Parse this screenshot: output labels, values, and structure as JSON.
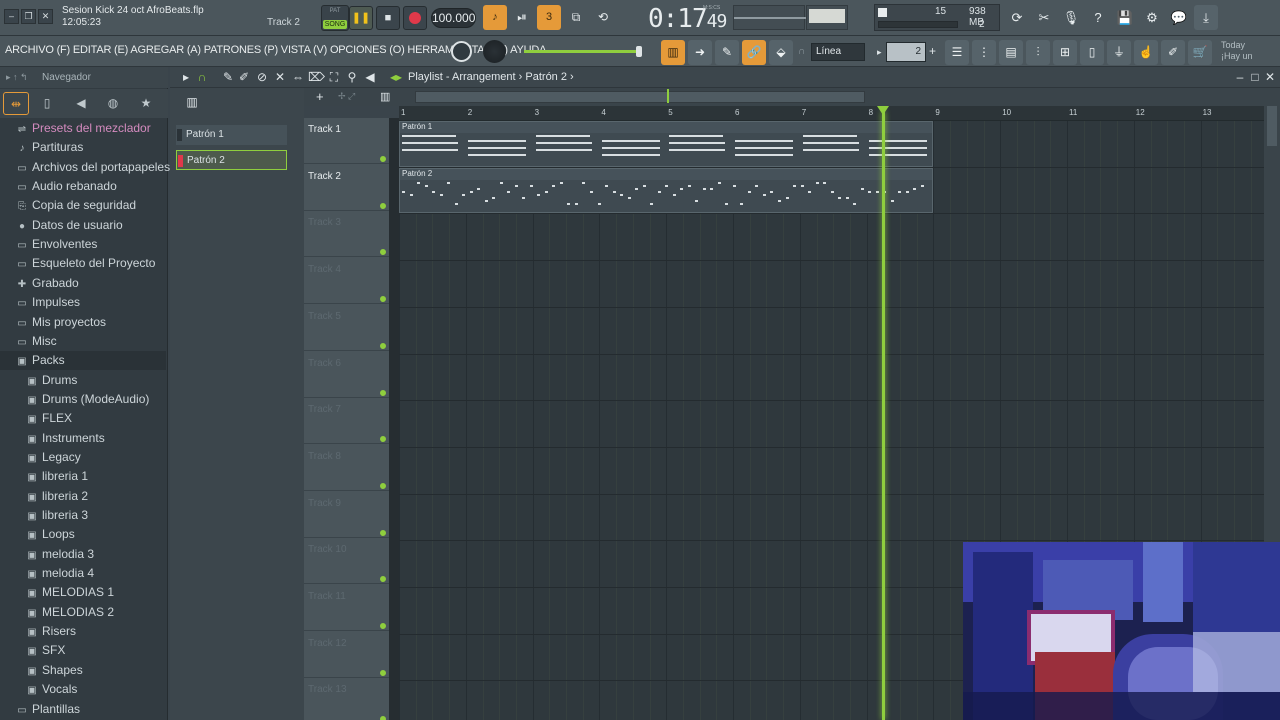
{
  "window": {
    "project_name": "Sesion Kick 24 oct AfroBeats.flp",
    "time": "12:05:23",
    "track_hint": "Track 2"
  },
  "transport": {
    "pat_label": "PAT",
    "song_label": "SONG",
    "tempo": "100.000",
    "clock_main": "0:17",
    "clock_sec": "49",
    "clock_unit": "M:S:CS",
    "cpu_percent": "15",
    "memory": "938 MB",
    "polyphony": "2"
  },
  "menu": {
    "text": "ARCHIVO (F) EDITAR (E) AGREGAR (A) PATRONES (P) VISTA (V) OPCIONES (O) HERRAMIENTAS (T) AYUDA"
  },
  "snap": {
    "mode": "Línea",
    "step_value": "2"
  },
  "news": {
    "line1": "Today",
    "line2": "¡Hay un"
  },
  "browser": {
    "title": "Navegador",
    "items": [
      {
        "label": "Presets del mezclador",
        "icon": "mixer-icon"
      },
      {
        "label": "Partituras",
        "icon": "note-icon"
      },
      {
        "label": "Archivos del portapapeles",
        "icon": "folder-icon"
      },
      {
        "label": "Audio rebanado",
        "icon": "folder-icon"
      },
      {
        "label": "Copia de seguridad",
        "icon": "backup-icon"
      },
      {
        "label": "Datos de usuario",
        "icon": "user-icon"
      },
      {
        "label": "Envolventes",
        "icon": "folder-icon"
      },
      {
        "label": "Esqueleto del Proyecto",
        "icon": "folder-icon"
      },
      {
        "label": "Grabado",
        "icon": "record-icon"
      },
      {
        "label": "Impulses",
        "icon": "folder-icon"
      },
      {
        "label": "Mis proyectos",
        "icon": "folder-icon"
      },
      {
        "label": "Misc",
        "icon": "folder-icon"
      },
      {
        "label": "Packs",
        "icon": "packs-icon"
      }
    ],
    "packs": [
      "Drums",
      "Drums (ModeAudio)",
      "FLEX",
      "Instruments",
      "Legacy",
      "libreria 1",
      "libreria 2",
      "libreria 3",
      "Loops",
      "melodia 3",
      "melodia 4",
      "MELODIAS 1",
      "MELODIAS 2",
      "Risers",
      "SFX",
      "Shapes",
      "Vocals"
    ],
    "bottom_item": "Plantillas"
  },
  "playlist": {
    "title": "Playlist - Arrangement",
    "current_pattern": "Patrón 2",
    "patterns": [
      "Patrón 1",
      "Patrón 2"
    ],
    "tracks": [
      "Track 1",
      "Track 2",
      "Track 3",
      "Track 4",
      "Track 5",
      "Track 6",
      "Track 7",
      "Track 8",
      "Track 9",
      "Track 10",
      "Track 11",
      "Track 12",
      "Track 13"
    ],
    "ruler": [
      "1",
      "2",
      "3",
      "4",
      "5",
      "6",
      "7",
      "8",
      "9",
      "10",
      "11",
      "12",
      "13"
    ],
    "clips": [
      {
        "label": "Patrón 1",
        "track": 1,
        "start_bar": 1,
        "length_bars": 8
      },
      {
        "label": "Patrón 2",
        "track": 2,
        "start_bar": 1,
        "length_bars": 8
      }
    ],
    "playhead_bar": 8.25
  },
  "colors": {
    "accent_green": "#8fce3e",
    "accent_orange": "#e59a39",
    "record_red": "#e0394a"
  }
}
